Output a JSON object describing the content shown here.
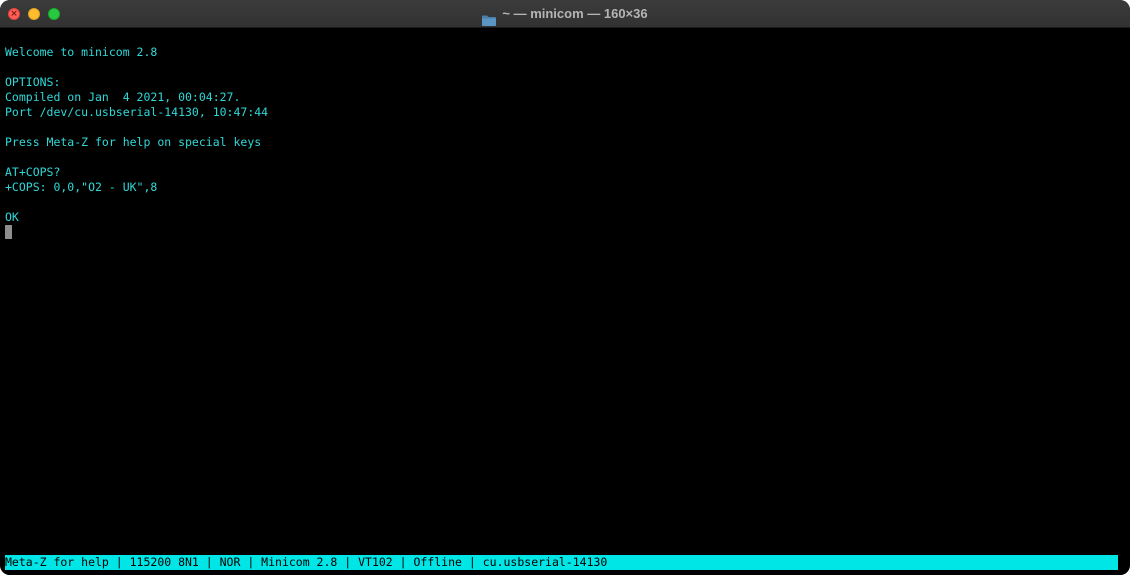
{
  "window": {
    "title": "~ — minicom — 160×36",
    "folder_icon": "folder-icon",
    "controls": [
      "close",
      "minimize",
      "zoom"
    ]
  },
  "terminal": {
    "lines": [
      "Welcome to minicom 2.8",
      "",
      "OPTIONS:",
      "Compiled on Jan  4 2021, 00:04:27.",
      "Port /dev/cu.usbserial-14130, 10:47:44",
      "",
      "Press Meta-Z for help on special keys",
      "",
      "AT+COPS?",
      "+COPS: 0,0,\"O2 - UK\",8",
      "",
      "OK"
    ],
    "status_bar": "Meta-Z for help | 115200 8N1 | NOR | Minicom 2.8 | VT102 | Offline | cu.usbserial-14130"
  },
  "colors": {
    "terminal_text": "#2fd8d8",
    "status_bar_bg": "#00e5e5",
    "background": "#000000"
  }
}
